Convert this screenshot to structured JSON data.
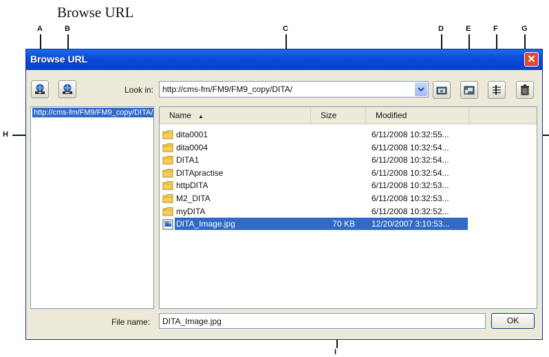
{
  "caption": "Browse URL",
  "callouts": {
    "A": "A",
    "B": "B",
    "C": "C",
    "D": "D",
    "E": "E",
    "F": "F",
    "G": "G",
    "H": "H",
    "I": "I"
  },
  "window": {
    "title": "Browse URL"
  },
  "toolbar": {
    "look_in_label": "Look in:",
    "look_in_value": "http://cms-fm/FM9/FM9_copy/DITA/"
  },
  "tree": {
    "selected": "http://cms-fm/FM9/FM9_copy/DITA/"
  },
  "list": {
    "columns": {
      "name": "Name",
      "size": "Size",
      "modified": "Modified"
    },
    "rows": [
      {
        "name": "dita0001",
        "size": "",
        "modified": "6/11/2008 10:32:55...",
        "type": "folder"
      },
      {
        "name": "dita0004",
        "size": "",
        "modified": "6/11/2008 10:32:54...",
        "type": "folder"
      },
      {
        "name": "DITA1",
        "size": "",
        "modified": "6/11/2008 10:32:54...",
        "type": "folder"
      },
      {
        "name": "DITApractise",
        "size": "",
        "modified": "6/11/2008 10:32:54...",
        "type": "folder"
      },
      {
        "name": "httpDITA",
        "size": "",
        "modified": "6/11/2008 10:32:53...",
        "type": "folder"
      },
      {
        "name": "M2_DITA",
        "size": "",
        "modified": "6/11/2008 10:32:53...",
        "type": "folder"
      },
      {
        "name": "myDITA",
        "size": "",
        "modified": "6/11/2008 10:32:52...",
        "type": "folder"
      },
      {
        "name": "DITA_Image.jpg",
        "size": "70 KB",
        "modified": "12/20/2007 3:10:53...",
        "type": "image",
        "selected": true
      }
    ]
  },
  "filename": {
    "label": "File name:",
    "value": "DITA_Image.jpg"
  },
  "ok_label": "OK",
  "icons": {
    "toolbar_a": "add-url-icon",
    "toolbar_b": "remove-url-icon",
    "toolbar_d": "new-folder-icon",
    "toolbar_e": "rename-icon",
    "toolbar_f": "properties-icon",
    "toolbar_g": "delete-icon",
    "folder": "folder-icon",
    "image_file": "image-file-icon",
    "close": "close-icon"
  },
  "colors": {
    "titlebar": "#0a4bd8",
    "selection": "#316ac5",
    "dialog_bg": "#ece9d8",
    "close": "#e0492b"
  }
}
